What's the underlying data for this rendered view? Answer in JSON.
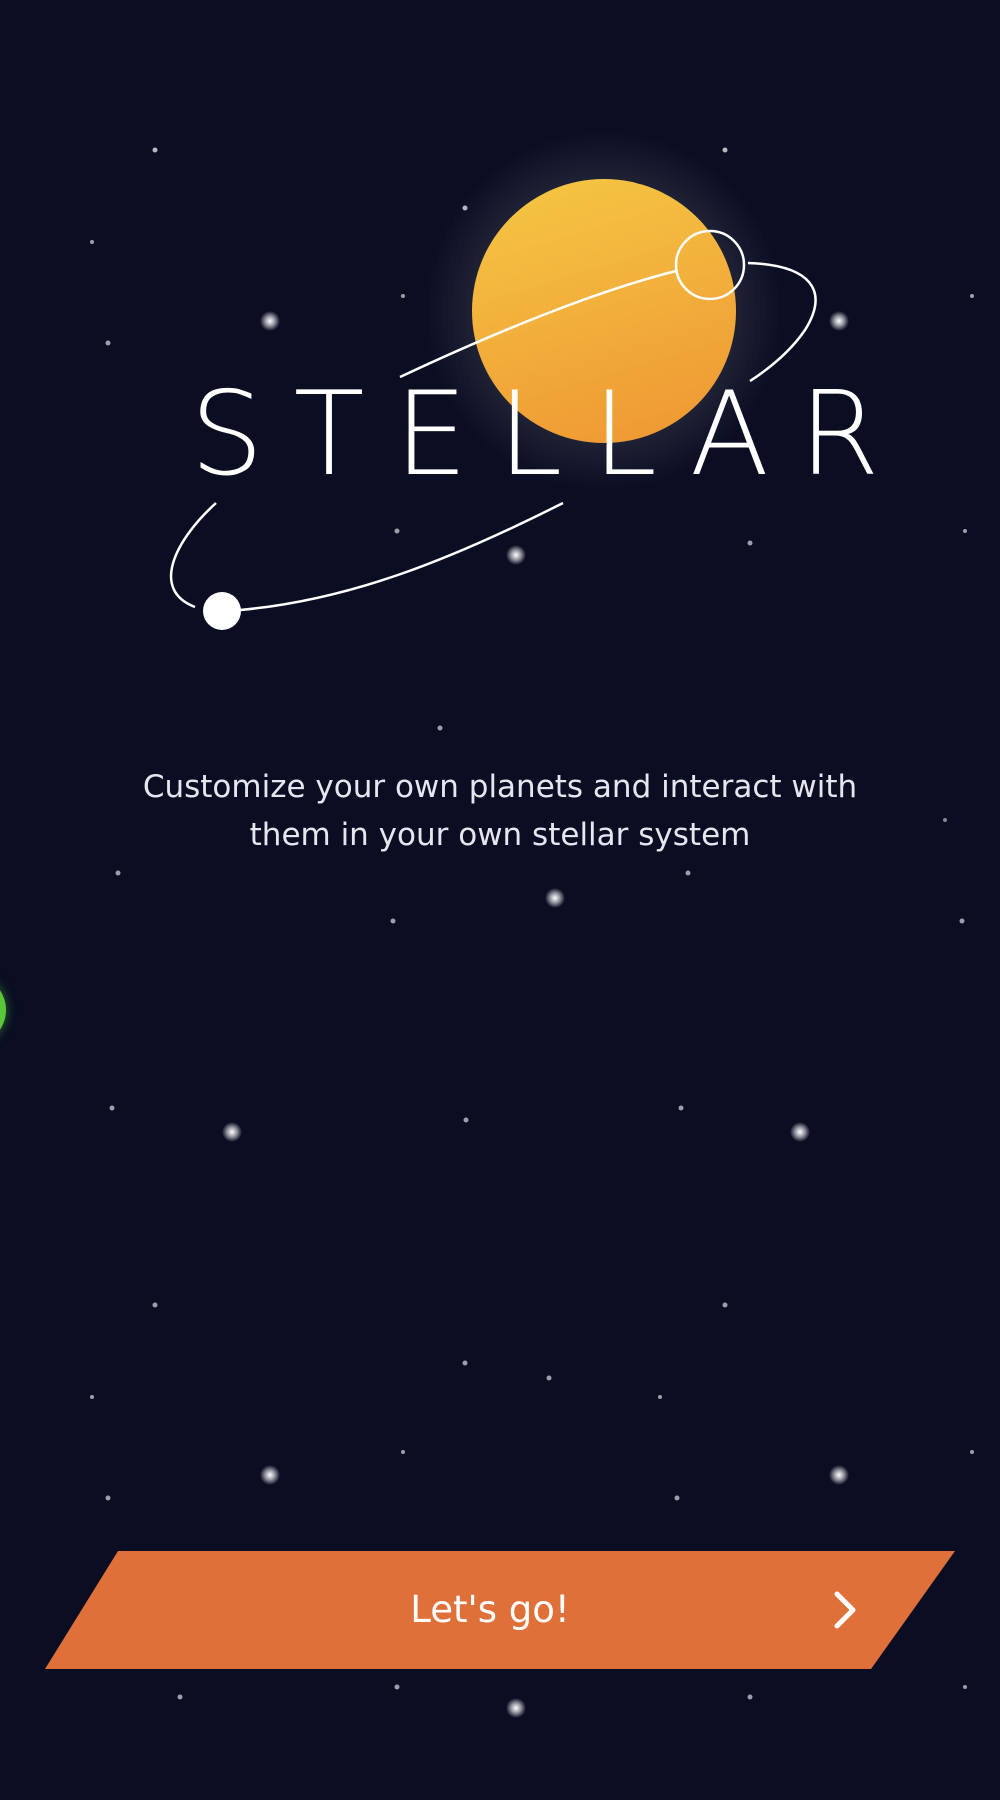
{
  "app": {
    "logo_text": "STELLAR",
    "tagline": "Customize your own planets and interact with them in your own stellar system"
  },
  "cta": {
    "label": "Let's go!",
    "icon": "chevron-right-icon",
    "color": "#e0703a"
  },
  "colors": {
    "background": "#0b0e23",
    "sun_top": "#f5c443",
    "sun_bottom": "#ef9a34",
    "side_planet": "#5ac73a"
  }
}
